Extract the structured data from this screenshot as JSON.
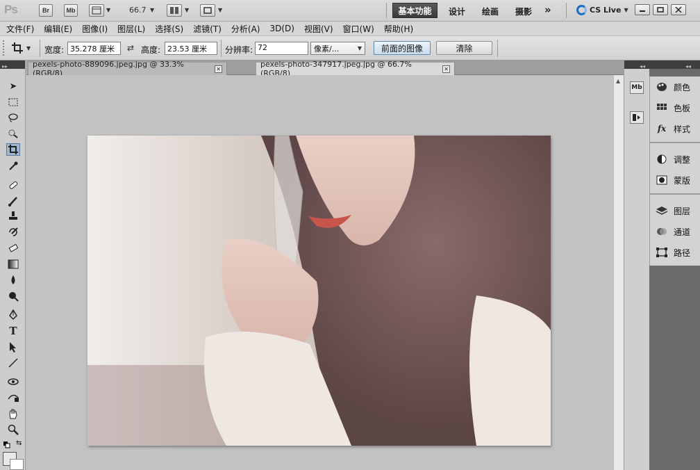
{
  "app": {
    "logo": "Ps",
    "bridge_label": "Br",
    "minibridge_label": "Mb",
    "zoom": "66.7",
    "workspaces": {
      "active": "基本功能",
      "design": "设计",
      "painting": "绘画",
      "photography": "摄影",
      "more": "»"
    },
    "cslive": "CS Live",
    "colors": {
      "accent": "#1b6fc2",
      "active_workspace": "#4a4a4a",
      "selected_button": "#c9dcef"
    }
  },
  "menu": [
    "文件(F)",
    "编辑(E)",
    "图像(I)",
    "图层(L)",
    "选择(S)",
    "滤镜(T)",
    "分析(A)",
    "3D(D)",
    "视图(V)",
    "窗口(W)",
    "帮助(H)"
  ],
  "options": {
    "width_label": "宽度:",
    "width_value": "35.278 厘米",
    "height_label": "高度:",
    "height_value": "23.53 厘米",
    "resolution_label": "分辨率:",
    "resolution_value": "72",
    "unit_select": "像素/...",
    "front_image_button": "前面的图像",
    "clear_button": "清除"
  },
  "tabs": [
    {
      "label": "pexels-photo-889096.jpeg.jpg @ 33.3%(RGB/8)",
      "active": false
    },
    {
      "label": "pexels-photo-347917.jpeg.jpg @ 66.7%(RGB/8)",
      "active": true
    }
  ],
  "tools": [
    "move-icon",
    "marquee-icon",
    "lasso-icon",
    "quick-select-icon",
    "crop-icon",
    "eyedropper-icon",
    "healing-brush-icon",
    "brush-icon",
    "clone-stamp-icon",
    "history-brush-icon",
    "eraser-icon",
    "gradient-icon",
    "blur-icon",
    "dodge-icon",
    "pen-icon",
    "type-icon",
    "path-select-icon",
    "line-icon",
    "3d-rotate-icon",
    "3d-orbit-icon",
    "hand-icon",
    "zoom-icon"
  ],
  "panels": {
    "color": "颜色",
    "swatches": "色板",
    "styles": "样式",
    "adjustments": "调整",
    "masks": "蒙版",
    "layers": "图层",
    "channels": "通道",
    "paths": "路径"
  }
}
